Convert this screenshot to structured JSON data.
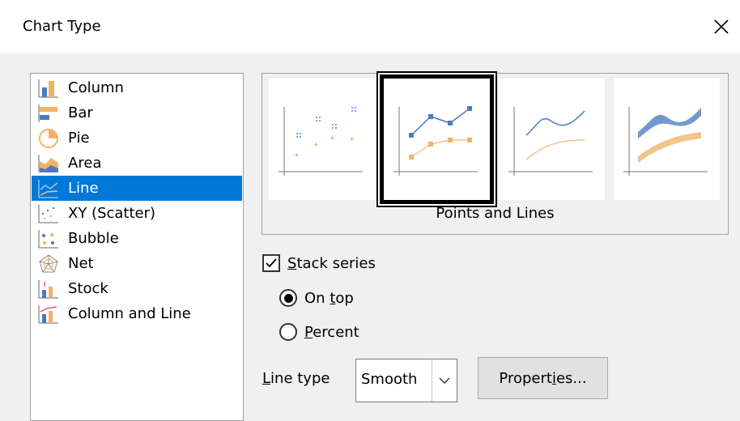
{
  "dialog": {
    "title": "Chart Type"
  },
  "chart_types": [
    {
      "label": "Column",
      "icon": "column-chart-icon"
    },
    {
      "label": "Bar",
      "icon": "bar-chart-icon"
    },
    {
      "label": "Pie",
      "icon": "pie-chart-icon"
    },
    {
      "label": "Area",
      "icon": "area-chart-icon"
    },
    {
      "label": "Line",
      "icon": "line-chart-icon",
      "selected": true
    },
    {
      "label": "XY (Scatter)",
      "icon": "scatter-chart-icon"
    },
    {
      "label": "Bubble",
      "icon": "bubble-chart-icon"
    },
    {
      "label": "Net",
      "icon": "net-chart-icon"
    },
    {
      "label": "Stock",
      "icon": "stock-chart-icon"
    },
    {
      "label": "Column and Line",
      "icon": "column-and-line-chart-icon"
    }
  ],
  "variants": {
    "selected_caption": "Points and Lines",
    "items": [
      "points-only",
      "points-and-lines",
      "lines-only",
      "3d-lines"
    ]
  },
  "options": {
    "stack_series": {
      "prefix": "",
      "accel": "S",
      "rest": "tack series",
      "checked": true
    },
    "on_top": {
      "prefix": "On ",
      "accel": "t",
      "rest": "op",
      "selected": true
    },
    "percent": {
      "prefix": "",
      "accel": "P",
      "rest": "ercent",
      "selected": false
    },
    "line_type": {
      "prefix": "",
      "accel": "L",
      "rest": "ine type",
      "value": "Smooth"
    },
    "properties": {
      "prefix": "Propert",
      "accel": "i",
      "rest": "es..."
    }
  },
  "colors": {
    "selection": "#0078d7",
    "series_blue": "#4a7bbf",
    "series_orange": "#f2b266"
  }
}
